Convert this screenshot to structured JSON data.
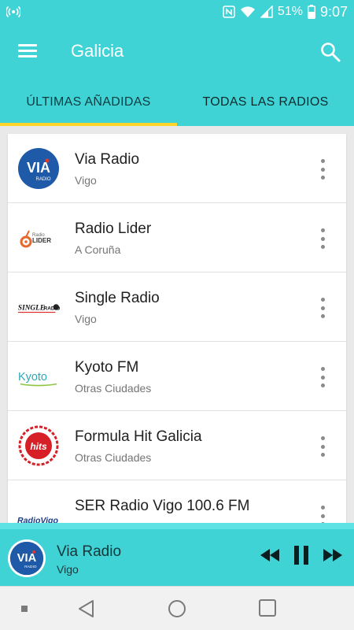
{
  "status": {
    "battery": "51%",
    "time": "9:07"
  },
  "appbar": {
    "title": "Galicia"
  },
  "tabs": [
    {
      "label": "ÚLTIMAS AÑADIDAS",
      "selected": true
    },
    {
      "label": "TODAS LAS RADIOS",
      "selected": false
    }
  ],
  "stations": [
    {
      "name": "Via Radio",
      "city": "Vigo",
      "logo_icon": "via-radio-logo"
    },
    {
      "name": "Radio Lider",
      "city": "A Coruña",
      "logo_icon": "radio-lider-logo"
    },
    {
      "name": "Single Radio",
      "city": "Vigo",
      "logo_icon": "single-radio-logo"
    },
    {
      "name": "Kyoto FM",
      "city": "Otras Ciudades",
      "logo_icon": "kyoto-fm-logo"
    },
    {
      "name": "Formula Hit Galicia",
      "city": "Otras Ciudades",
      "logo_icon": "formula-hit-logo"
    },
    {
      "name": "SER Radio Vigo 100.6 FM",
      "city": "",
      "logo_icon": "radio-vigo-logo"
    }
  ],
  "player": {
    "name": "Via Radio",
    "city": "Vigo",
    "state": "playing"
  },
  "colors": {
    "primary": "#3fd3d6",
    "tab_indicator": "#ffd52a",
    "logo_blue": "#1e5aa8",
    "logo_red": "#e23a2a"
  }
}
